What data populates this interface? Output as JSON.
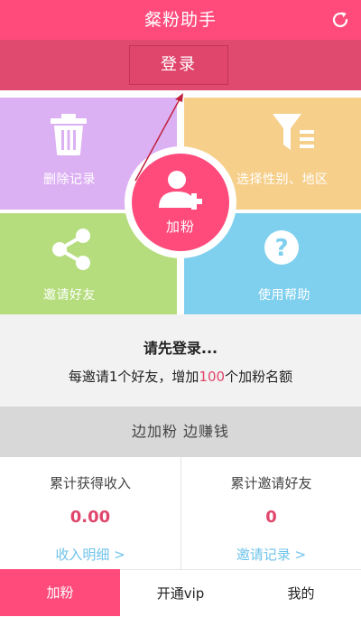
{
  "header": {
    "title": "粲粉助手",
    "refresh_icon": "refresh-icon"
  },
  "login": {
    "label": "登录"
  },
  "tiles": {
    "delete": {
      "label": "删除记录",
      "icon": "trash-icon"
    },
    "filter": {
      "label": "选择性别、地区",
      "icon": "filter-icon"
    },
    "share": {
      "label": "邀请好友",
      "icon": "share-icon"
    },
    "help": {
      "label": "使用帮助",
      "icon": "question-icon"
    }
  },
  "center": {
    "label": "加粉",
    "icon": "add-user-icon"
  },
  "notice": {
    "line1": "请先登录...",
    "line2_prefix": "每邀请1个好友，增加",
    "line2_highlight": "100",
    "line2_suffix": "个加粉名额"
  },
  "slogan": "边加粉 边赚钱",
  "stats": {
    "income": {
      "title": "累计获得收入",
      "value": "0.00",
      "link": "收入明细 >"
    },
    "invites": {
      "title": "累计邀请好友",
      "value": "0",
      "link": "邀请记录 >"
    }
  },
  "nav": {
    "items": [
      {
        "label": "加粉"
      },
      {
        "label": "开通vip"
      },
      {
        "label": "我的"
      }
    ]
  },
  "colors": {
    "brand": "#ff4b7c",
    "login_strip": "#df4a6e",
    "tile_delete": "#dcb1f3",
    "tile_filter": "#f6cf8a",
    "tile_share": "#b5dd7e",
    "tile_help": "#7fd0ee",
    "link": "#6fc3ea"
  }
}
